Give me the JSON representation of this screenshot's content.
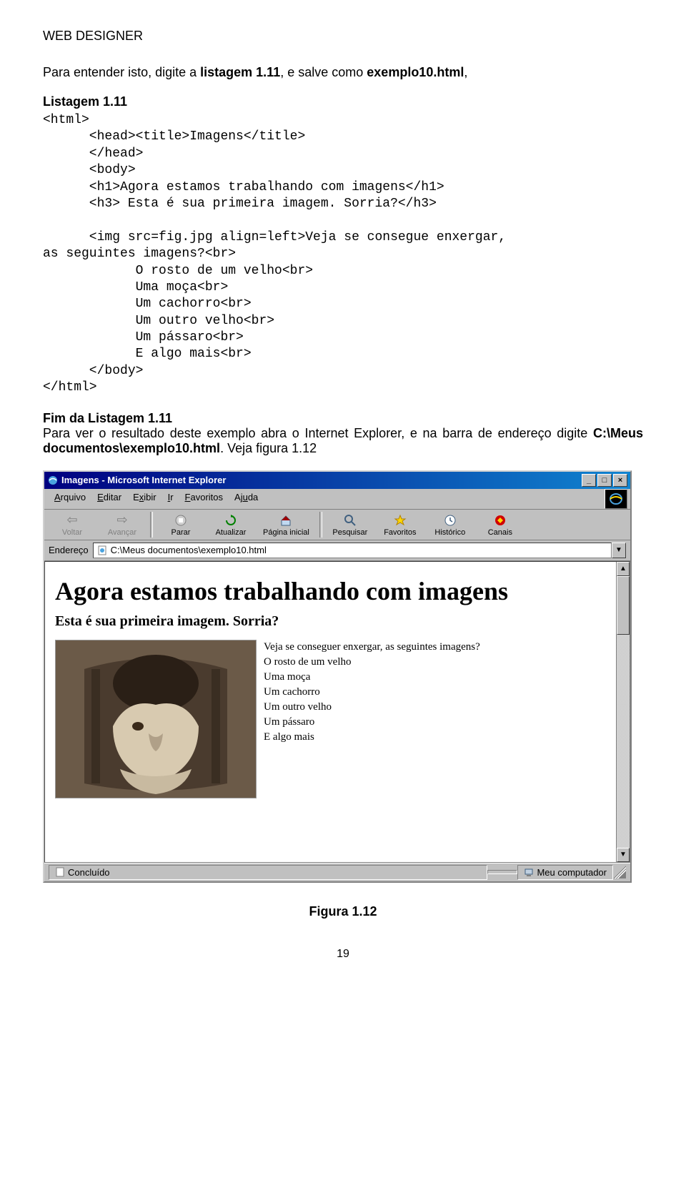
{
  "header": "WEB DESIGNER",
  "para1_prefix": "Para entender isto, digite a ",
  "para1_bold": "listagem 1.11",
  "para1_suffix": ", e salve como ",
  "para1_bold2": "exemplo10.html",
  "para1_end": ",",
  "listing_label": "Listagem 1.11",
  "code": "<html>\n      <head><title>Imagens</title>\n      </head>\n      <body>\n      <h1>Agora estamos trabalhando com imagens</h1>\n      <h3> Esta é sua primeira imagem. Sorria?</h3>\n\n      <img src=fig.jpg align=left>Veja se consegue enxergar,\nas seguintes imagens?<br>\n            O rosto de um velho<br>\n            Uma moça<br>\n            Um cachorro<br>\n            Um outro velho<br>\n            Um pássaro<br>\n            E algo mais<br>\n      </body>\n</html>",
  "fim_label": "Fim da Listagem 1.11",
  "after_text_1": "Para ver o resultado deste exemplo abra o Internet Explorer, e na barra de endereço digite ",
  "after_bold": "C:\\Meus documentos\\exemplo10.html",
  "after_text_2": ". Veja figura 1.12",
  "browser": {
    "title": "Imagens - Microsoft Internet Explorer",
    "menus": {
      "m1": "Arquivo",
      "m2": "Editar",
      "m3": "Exibir",
      "m4": "Ir",
      "m5": "Favoritos",
      "m6": "Ajuda"
    },
    "toolbar": {
      "back": "Voltar",
      "forward": "Avançar",
      "stop": "Parar",
      "refresh": "Atualizar",
      "home": "Página inicial",
      "search": "Pesquisar",
      "favorites": "Favoritos",
      "history": "Histórico",
      "channels": "Canais"
    },
    "address_label": "Endereço",
    "address_value": "C:\\Meus documentos\\exemplo10.html",
    "content": {
      "h1": "Agora estamos trabalhando com imagens",
      "h3": "Esta é sua primeira imagem. Sorria?",
      "line1": "Veja se conseguer enxergar, as seguintes imagens?",
      "line2": "O rosto de um velho",
      "line3": "Uma moça",
      "line4": "Um cachorro",
      "line5": "Um outro velho",
      "line6": "Um pássaro",
      "line7": "E algo mais"
    },
    "status_left": "Concluído",
    "status_right": "Meu computador"
  },
  "figure_caption": "Figura 1.12",
  "page_number": "19"
}
